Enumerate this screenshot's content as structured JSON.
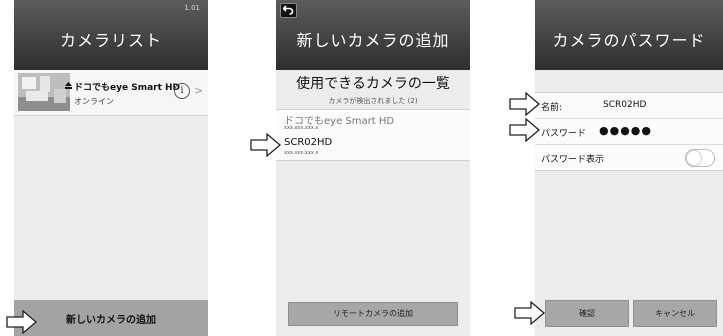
{
  "screen1": {
    "title": "カメラリスト",
    "version": "1.01",
    "camera": {
      "name": "ドコでもeye Smart HD",
      "status": "オンライン"
    },
    "add_button": "新しいカメラの追加"
  },
  "screen2": {
    "title": "新しいカメラの追加",
    "list_heading": "使用できるカメラの一覧",
    "detected": "カメラが検出されました (2)",
    "cameras": [
      {
        "name": "ドコでもeye Smart HD",
        "ip": "xxx.xxx.xxx.x"
      },
      {
        "name": "SCR02HD",
        "ip": "xxx.xxx.xxx.x"
      }
    ],
    "remote_button": "リモートカメラの追加"
  },
  "screen3": {
    "title": "カメラのパスワード",
    "name_label": "名前:",
    "name_value": "SCR02HD",
    "password_label": "パスワード",
    "password_value": "●●●●●",
    "show_password_label": "パスワード表示",
    "ok_button": "確認",
    "cancel_button": "キャンセル"
  }
}
